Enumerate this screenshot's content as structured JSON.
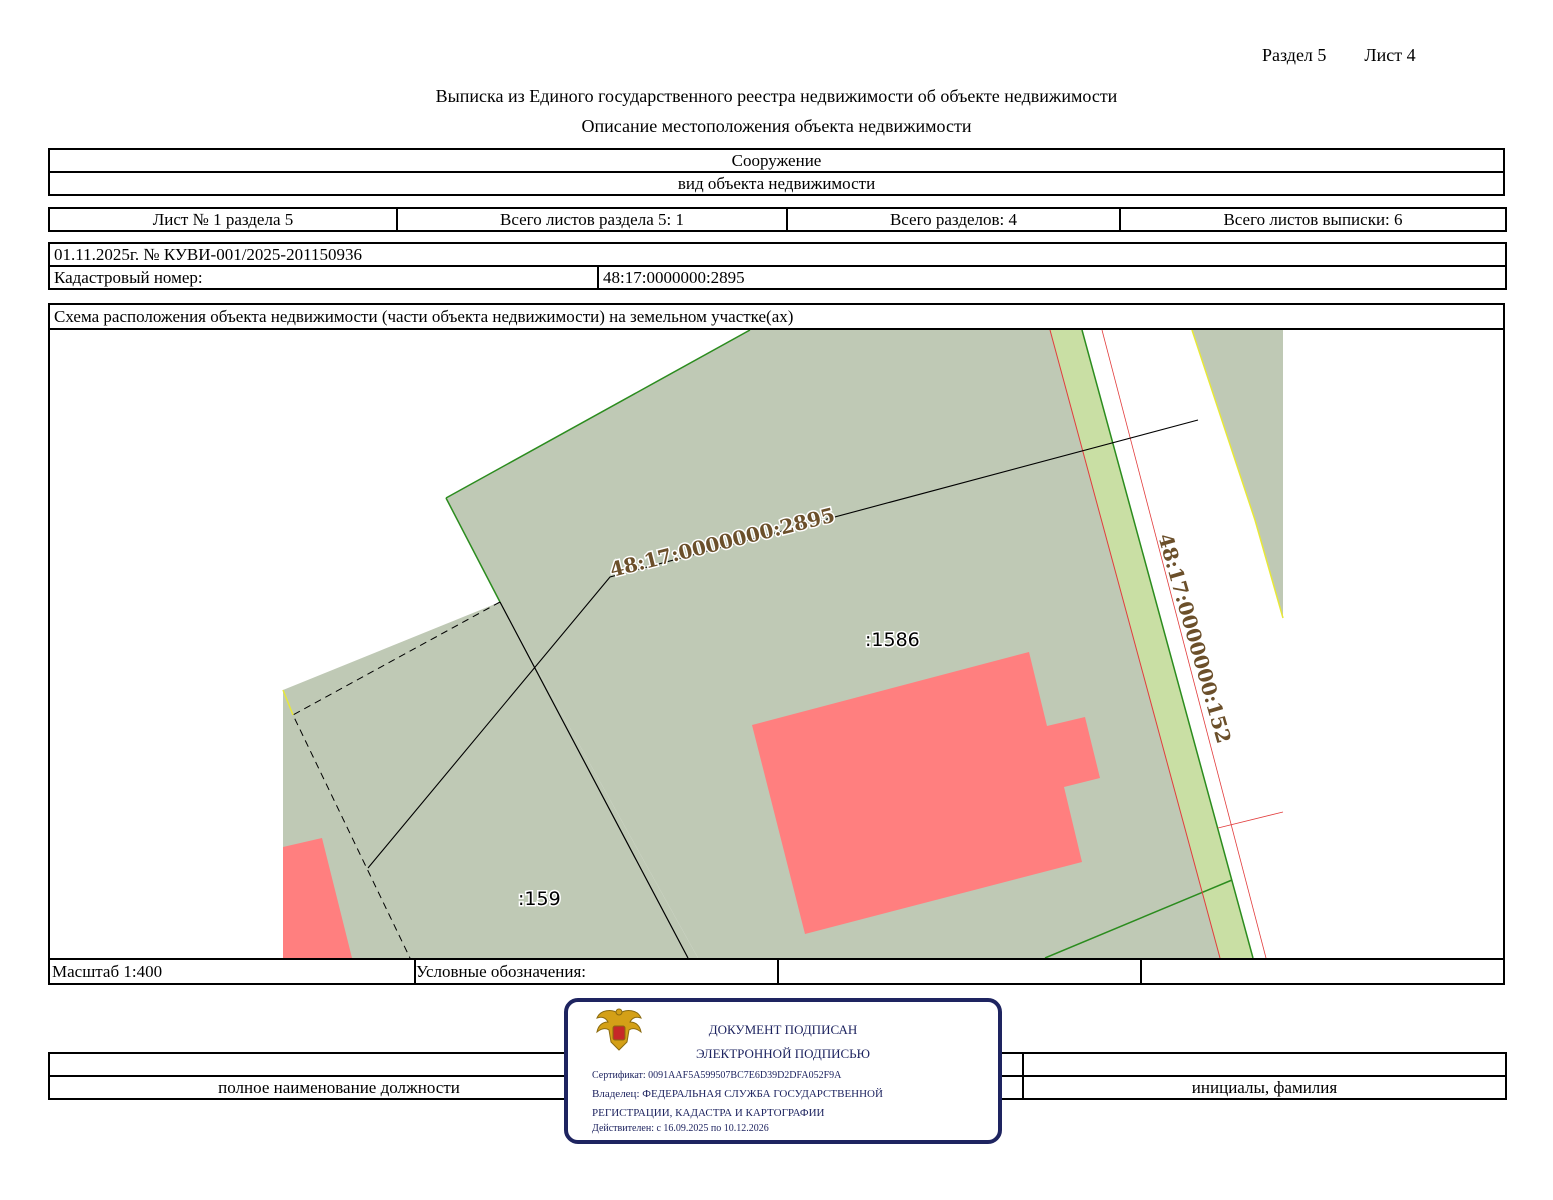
{
  "header": {
    "section": "Раздел 5",
    "sheet": "Лист 4",
    "title": "Выписка из Единого государственного реестра недвижимости об объекте недвижимости",
    "subtitle": "Описание местоположения объекта недвижимости"
  },
  "object": {
    "type_value": "Сооружение",
    "type_caption": "вид объекта недвижимости"
  },
  "sheets": {
    "sheet_no": "Лист № 1 раздела 5",
    "total_section_sheets": "Всего листов раздела 5: 1",
    "total_sections": "Всего разделов: 4",
    "total_extract_sheets": "Всего листов выписки: 6"
  },
  "record": {
    "date_number": "01.11.2025г. № КУВИ-001/2025-201150936",
    "cadastral_label": "Кадастровый номер:",
    "cadastral_value": "48:17:0000000:2895"
  },
  "map": {
    "caption": "Схема расположения объекта недвижимости (части объекта недвижимости) на земельном участке(ах)",
    "labels": {
      "object_number": "48:17:0000000:2895",
      "road_number": "48:17:0000000:152",
      "parcel_1586": ":1586",
      "parcel_159": ":159"
    },
    "colors": {
      "parcel_fill": "#bfc9b5",
      "building_fill": "#ff7f7f",
      "road_fill": "#c9dfa4",
      "boundary_green": "#2b8c1e",
      "boundary_red": "#e23c3c",
      "label_brown": "#6b4f2a"
    },
    "scale": "Масштаб 1:400",
    "legend_label": "Условные обозначения:"
  },
  "signature": {
    "position_caption": "полное наименование должности",
    "name_caption": "инициалы, фамилия"
  },
  "stamp": {
    "line1": "ДОКУМЕНТ ПОДПИСАН",
    "line2": "ЭЛЕКТРОННОЙ ПОДПИСЬЮ",
    "certificate": "Сертификат: 0091AAF5A599507BC7E6D39D2DFA052F9A",
    "owner": "Владелец: ФЕДЕРАЛЬНАЯ СЛУЖБА ГОСУДАРСТВЕННОЙ",
    "owner2": "РЕГИСТРАЦИИ, КАДАСТРА И КАРТОГРАФИИ",
    "valid": "Действителен: с 16.09.2025 по 10.12.2026",
    "color": "#1e2460",
    "emblem_icon": "double-headed-eagle-emblem-icon"
  }
}
